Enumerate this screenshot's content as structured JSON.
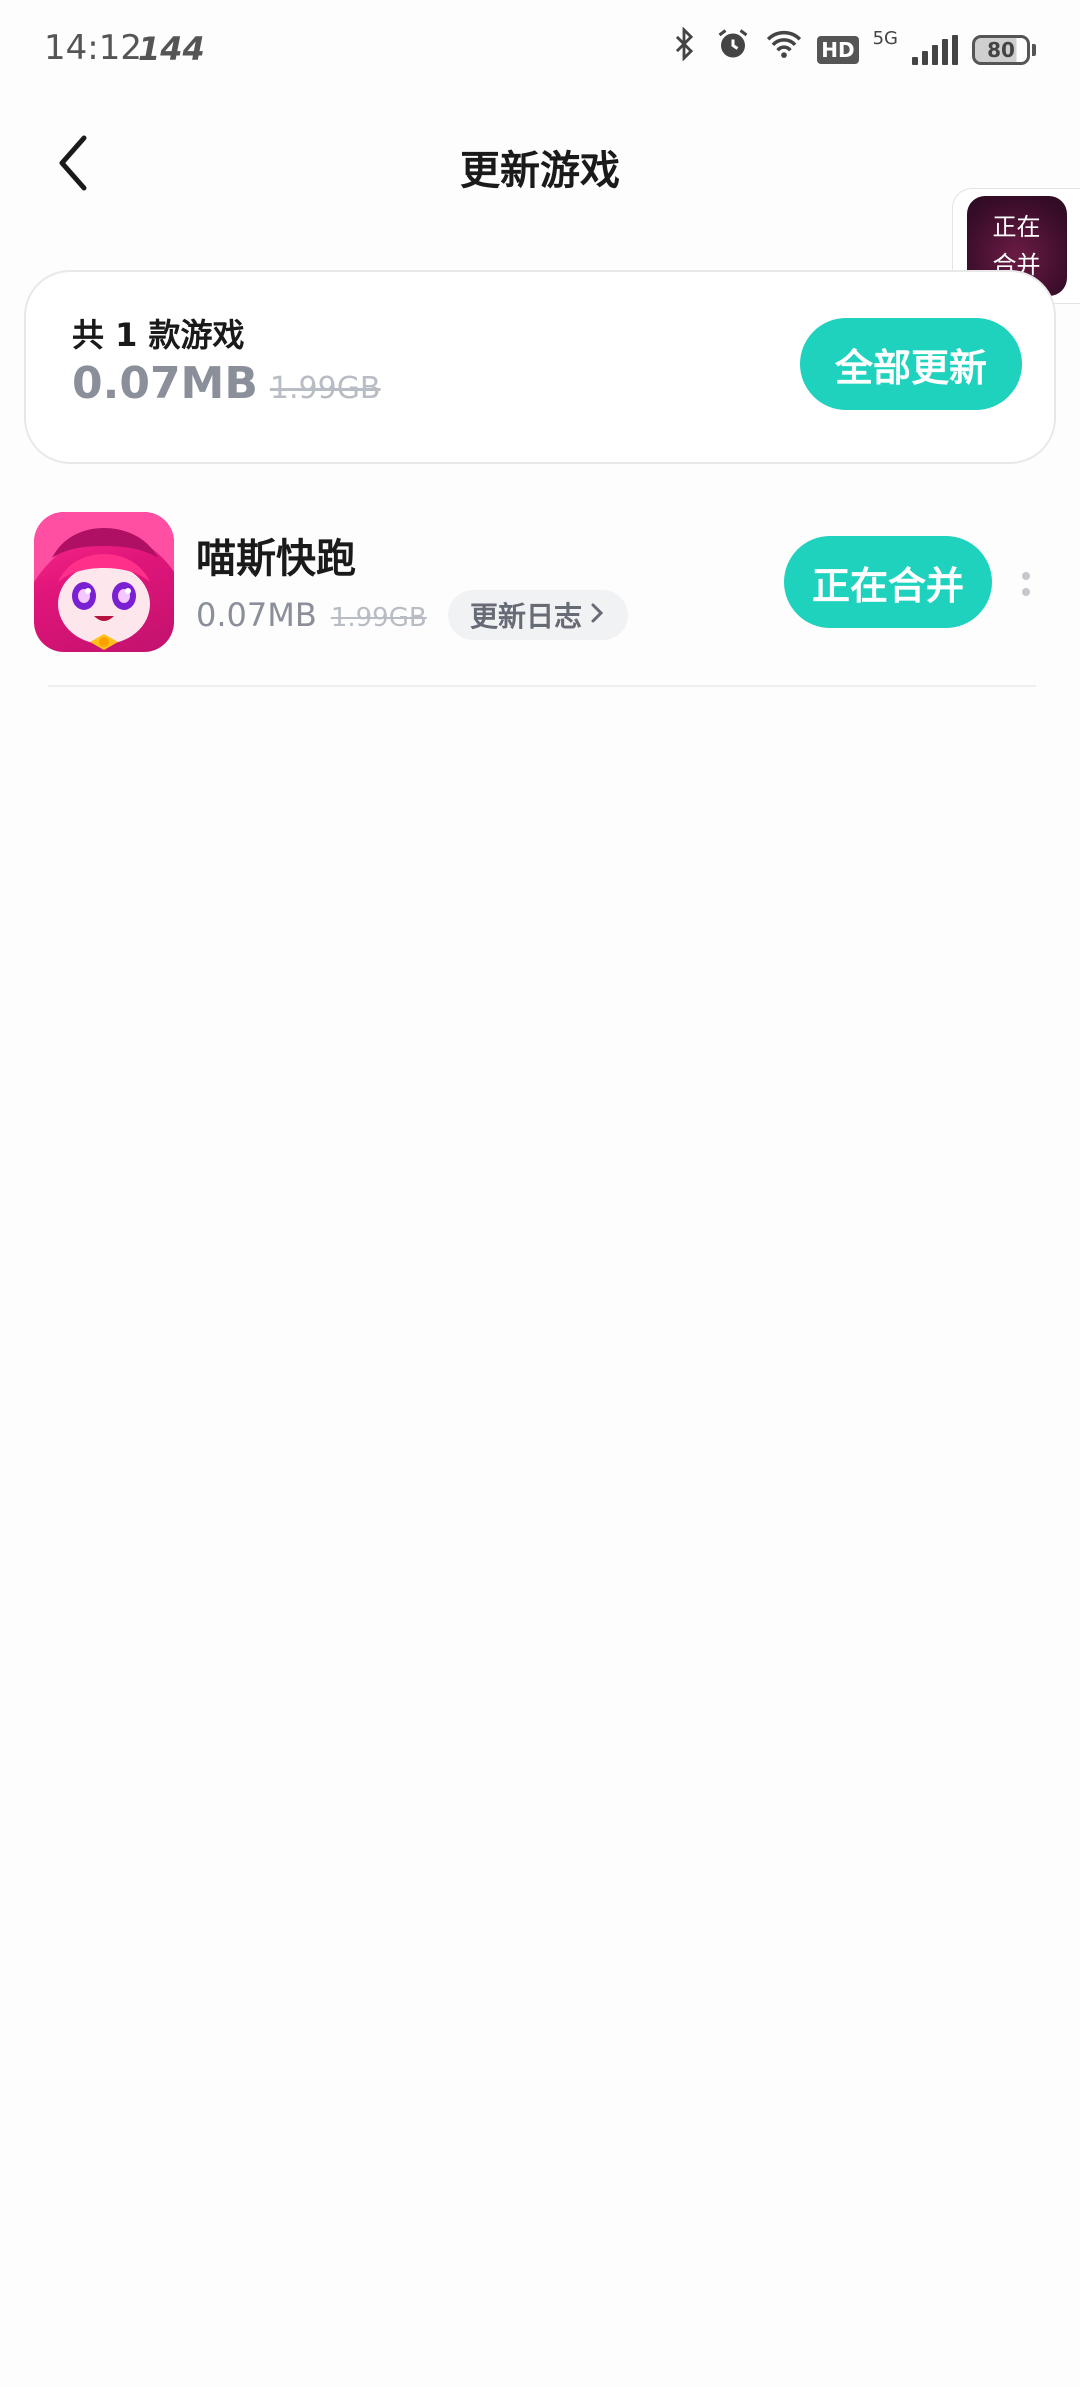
{
  "status_bar": {
    "time": "14:12",
    "refresh": "144",
    "network": "5G",
    "hd": "HD",
    "battery": "80"
  },
  "header": {
    "title": "更新游戏",
    "back_icon": "chevron-left-icon"
  },
  "floating_widget": {
    "label_line1": "正在",
    "label_line2": "合并"
  },
  "summary": {
    "count_text": "共 1 款游戏",
    "size_new": "0.07MB",
    "size_old": "1.99GB",
    "update_all_label": "全部更新"
  },
  "games": [
    {
      "name": "喵斯快跑",
      "size_new": "0.07MB",
      "size_old": "1.99GB",
      "changelog_label": "更新日志",
      "action_label": "正在合并"
    }
  ],
  "colors": {
    "accent": "#1ed2bd",
    "muted_text": "#8a8f99",
    "strike_text": "#b8bcc4"
  }
}
